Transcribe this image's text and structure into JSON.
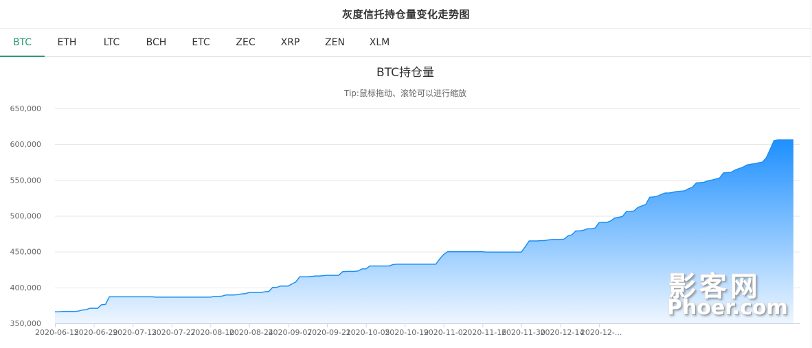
{
  "header": {
    "title": "灰度信托持仓量变化走势图"
  },
  "tabs": [
    {
      "label": "BTC",
      "active": true
    },
    {
      "label": "ETH",
      "active": false
    },
    {
      "label": "LTC",
      "active": false
    },
    {
      "label": "BCH",
      "active": false
    },
    {
      "label": "ETC",
      "active": false
    },
    {
      "label": "ZEC",
      "active": false
    },
    {
      "label": "XRP",
      "active": false
    },
    {
      "label": "ZEN",
      "active": false
    },
    {
      "label": "XLM",
      "active": false
    }
  ],
  "watermark": {
    "cn": "影客网",
    "en": "Phoer.com"
  },
  "colors": {
    "accent": "#2d9a73",
    "line": "#1c8ff0",
    "fill_top": "#1e90ff",
    "fill_bottom": "#eef6ff"
  },
  "chart_data": {
    "type": "area",
    "title": "BTC持仓量",
    "subtitle": "Tip:鼠标拖动、滚轮可以进行缩放",
    "xlabel": "",
    "ylabel": "",
    "ylim": [
      350000,
      650000
    ],
    "yticks": [
      "650,000",
      "600,000",
      "550,000",
      "500,000",
      "450,000",
      "400,000",
      "350,000"
    ],
    "ytick_values": [
      650000,
      600000,
      550000,
      500000,
      450000,
      400000,
      350000
    ],
    "xticks": [
      "2020-06-15",
      "2020-06-29",
      "2020-07-13",
      "2020-07-27",
      "2020-08-10",
      "2020-08-24",
      "2020-09-07",
      "2020-09-21",
      "2020-10-05",
      "2020-10-19",
      "2020-11-02",
      "2020-11-16",
      "2020-11-30",
      "2020-12-14",
      "2020-12-..."
    ],
    "xtick_index": [
      0,
      10,
      20,
      30,
      40,
      50,
      60,
      70,
      80,
      90,
      100,
      110,
      120,
      130,
      140
    ],
    "grid": true,
    "legend": "none",
    "series": [
      {
        "values": [
          366000,
          366000,
          366500,
          366500,
          366500,
          366500,
          367000,
          368500,
          369000,
          371000,
          371000,
          371000,
          376000,
          376500,
          387000,
          387000,
          387000,
          387000,
          387000,
          387000,
          387000,
          387000,
          387000,
          387000,
          387000,
          387000,
          386500,
          386500,
          386500,
          386500,
          386500,
          386500,
          386500,
          386500,
          386500,
          386500,
          386500,
          386500,
          386500,
          386500,
          386500,
          387500,
          387500,
          388000,
          389500,
          389500,
          389500,
          390000,
          391000,
          391500,
          393000,
          393000,
          393000,
          393000,
          394000,
          394500,
          400000,
          400000,
          402000,
          402000,
          402000,
          405000,
          408000,
          415000,
          415000,
          415000,
          415500,
          416000,
          416000,
          416500,
          417000,
          417000,
          417000,
          417000,
          422000,
          422500,
          422500,
          422500,
          423000,
          426000,
          426000,
          430000,
          430000,
          430000,
          430000,
          430000,
          430000,
          432000,
          432500,
          432500,
          432500,
          432500,
          432500,
          432500,
          432500,
          432500,
          432500,
          432500,
          432500,
          440000,
          446000,
          450000,
          450000,
          450000,
          450000,
          450000,
          450000,
          450000,
          450000,
          450000,
          450000,
          449500,
          449500,
          449500,
          449500,
          449500,
          449500,
          449500,
          449500,
          449500,
          449500,
          457000,
          465000,
          465000,
          465000,
          465500,
          465500,
          466500,
          467000,
          467000,
          467000,
          467500,
          472000,
          473500,
          479000,
          479000,
          480000,
          482000,
          482000,
          483000,
          490500,
          491000,
          491000,
          493000,
          497000,
          498000,
          499000,
          506000,
          506000,
          507000,
          512000,
          514000,
          516000,
          526000,
          526500,
          527500,
          530000,
          532000,
          532000,
          533000,
          534000,
          534500,
          535000,
          538000,
          540000,
          546000,
          546500,
          547000,
          549000,
          550000,
          551500,
          553000,
          560000,
          560500,
          561000,
          564000,
          566000,
          568000,
          571000,
          572000,
          573000,
          574000,
          575000,
          581000,
          593000,
          605000,
          606000,
          606000,
          606000,
          606000,
          606000
        ]
      }
    ]
  }
}
